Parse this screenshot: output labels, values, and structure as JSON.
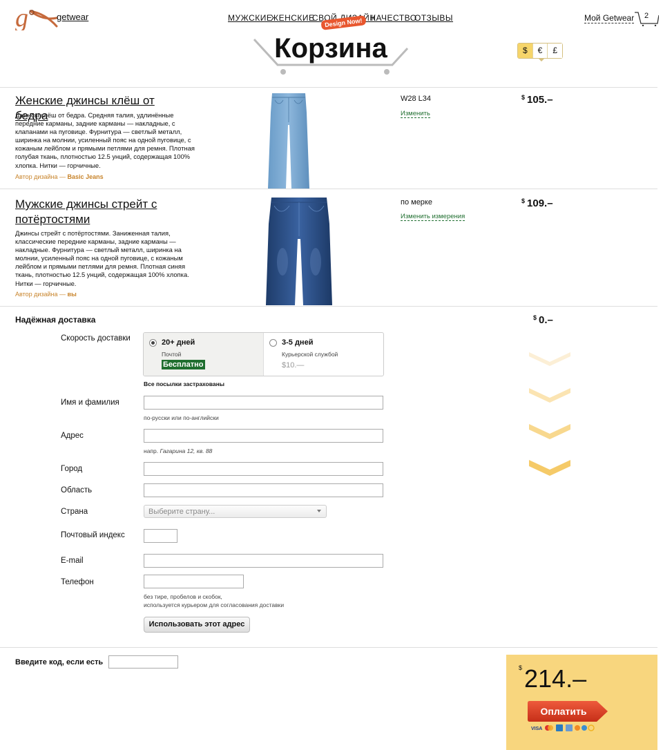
{
  "header": {
    "brand": "getwear",
    "nav": [
      "МУЖСКИЕ",
      "ЖЕНСКИЕ",
      "СВОЙ ДИЗАЙН",
      "КАЧЕСТВО",
      "ОТЗЫВЫ"
    ],
    "design_badge": "Design Now!",
    "my_account": "Мой Getwear",
    "cart_count": "2"
  },
  "page_title": "Корзина",
  "currency": {
    "options": [
      "$",
      "€",
      "£"
    ],
    "selected": "$"
  },
  "products": [
    {
      "name": "Женские джинсы клёш от бедра",
      "description": "Джинсы клёш от бедра. Средняя талия, удлинённые передние карманы, задние карманы — накладные, с клапанами на пуговице. Фурнитура — светлый металл, ширинка на молнии, усиленный пояс на одной пуговице, с кожаным лейблом и прямыми петлями для ремня. Плотная голубая ткань, плотностью 12.5 унций, содержащая 100% хлопка. Нитки — горчичные.",
      "author_label": "Автор дизайна — ",
      "author": "Basic Jeans",
      "size": "W28 L34",
      "change": "Изменить",
      "price_symbol": "$",
      "price": "105.–"
    },
    {
      "name": "Мужские джинсы стрейт с потёртостями",
      "description": "Джинсы стрейт с потёртостями. Заниженная талия, классические передние карманы, задние карманы — накладные. Фурнитура — светлый металл, ширинка на молнии, усиленный пояс на одной пуговице, с кожаным лейблом и прямыми петлями для ремня. Плотная синяя ткань, плотностью 12.5 унций, содержащая 100% хлопка. Нитки — горчичные.",
      "author_label": "Автор дизайна — ",
      "author": "вы",
      "size": "по мерке",
      "change": "Изменить измерения",
      "price_symbol": "$",
      "price": "109.–"
    }
  ],
  "delivery": {
    "heading": "Надёжная доставка",
    "price_symbol": "$",
    "price": "0.–",
    "speed_label": "Скорость доставки",
    "options": [
      {
        "title": "20+ дней",
        "sub": "Почтой",
        "price": "Бесплатно",
        "selected": true
      },
      {
        "title": "3-5 дней",
        "sub": "Курьерской службой",
        "price": "$10.—",
        "selected": false
      }
    ],
    "insured_note": "Все посылки застрахованы",
    "fields": {
      "name_label": "Имя и фамилия",
      "name_hint": "по-русски или по-английски",
      "address_label": "Адрес",
      "address_hint_prefix": "напр. ",
      "address_hint_example": "Гагарина 12, кв. 88",
      "city_label": "Город",
      "region_label": "Область",
      "country_label": "Страна",
      "country_placeholder": "Выберите страну...",
      "zip_label": "Почтовый индекс",
      "email_label": "E-mail",
      "phone_label": "Телефон",
      "phone_hint_1": "без тире, пробелов и скобок,",
      "phone_hint_2": "используется курьером для согласования доставки"
    },
    "use_address_button": "Использовать этот адрес"
  },
  "promo": {
    "label": "Введите код, если есть"
  },
  "total": {
    "symbol": "$",
    "amount": "214.–",
    "pay_button": "Оплатить"
  },
  "colors": {
    "accent": "#f8d67e",
    "pay": "#d93a22",
    "green": "#1f6e2f",
    "author": "#c8842b"
  }
}
